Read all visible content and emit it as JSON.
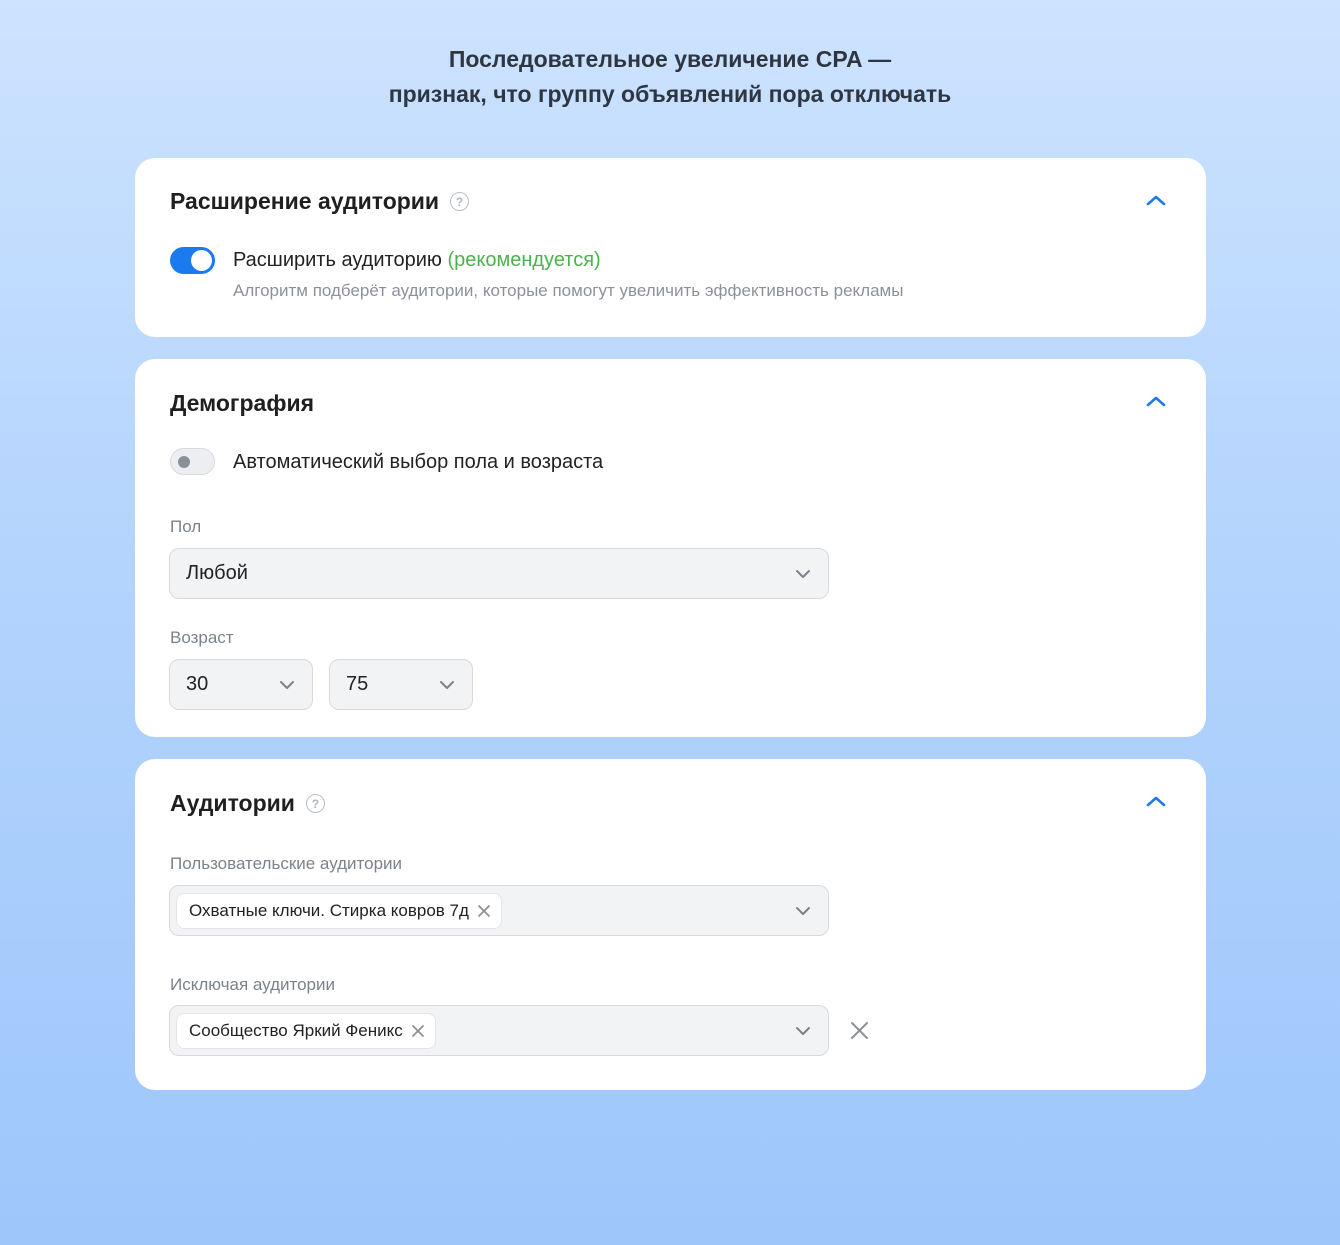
{
  "headline": {
    "line1": "Последовательное увеличение CPA —",
    "line2": "признак, что группу объявлений пора отключать"
  },
  "colors": {
    "accent": "#1a7af0",
    "recommended": "#4bb34b"
  },
  "audience_expansion": {
    "title": "Расширение аудитории",
    "help_icon": "?",
    "toggle_on": true,
    "toggle_label": "Расширить аудиторию",
    "toggle_recommended": "(рекомендуется)",
    "toggle_description": "Алгоритм подберёт аудитории, которые помогут увеличить эффективность рекламы"
  },
  "demography": {
    "title": "Демография",
    "auto_toggle_on": false,
    "auto_toggle_label": "Автоматический выбор пола и возраста",
    "gender_label": "Пол",
    "gender_value": "Любой",
    "age_label": "Возраст",
    "age_from": "30",
    "age_to": "75"
  },
  "audiences": {
    "title": "Аудитории",
    "help_icon": "?",
    "custom_label": "Пользовательские аудитории",
    "custom_chips": [
      "Охватные ключи. Стирка ковров 7д"
    ],
    "exclude_label": "Исключая аудитории",
    "exclude_chips": [
      "Сообщество Яркий Феникс"
    ]
  }
}
